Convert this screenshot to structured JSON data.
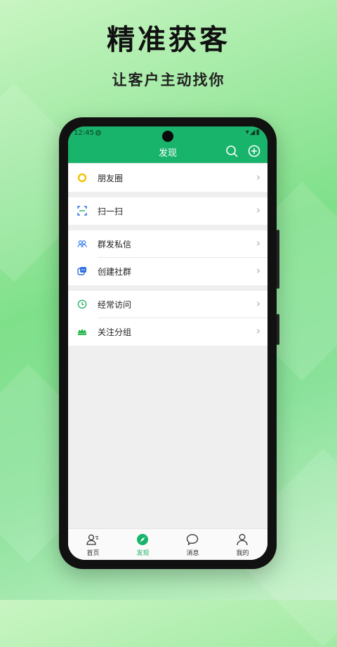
{
  "promo": {
    "title": "精准获客",
    "subtitle": "让客户主动找你"
  },
  "statusbar": {
    "time": "12:45"
  },
  "header": {
    "title": "发现"
  },
  "sections": [
    {
      "items": [
        {
          "label": "朋友圈",
          "icon": "moments-icon",
          "color": "#f2c200"
        }
      ]
    },
    {
      "items": [
        {
          "label": "扫一扫",
          "icon": "scan-icon",
          "color": "#2e6fe0"
        }
      ]
    },
    {
      "items": [
        {
          "label": "群发私信",
          "icon": "broadcast-icon",
          "color": "#4a8bf5"
        },
        {
          "label": "创建社群",
          "icon": "create-group-icon",
          "color": "#2e6fe0"
        }
      ]
    },
    {
      "items": [
        {
          "label": "经常访问",
          "icon": "clock-icon",
          "color": "#2fb56a"
        },
        {
          "label": "关注分组",
          "icon": "follow-group-icon",
          "color": "#26b54a"
        }
      ]
    }
  ],
  "tabs": [
    {
      "label": "首页",
      "icon": "contacts-icon",
      "active": false
    },
    {
      "label": "发现",
      "icon": "compass-icon",
      "active": true
    },
    {
      "label": "消息",
      "icon": "chat-icon",
      "active": false
    },
    {
      "label": "我的",
      "icon": "profile-icon",
      "active": false
    }
  ],
  "colors": {
    "brand": "#19b46b",
    "active_tab": "#19b46b"
  }
}
